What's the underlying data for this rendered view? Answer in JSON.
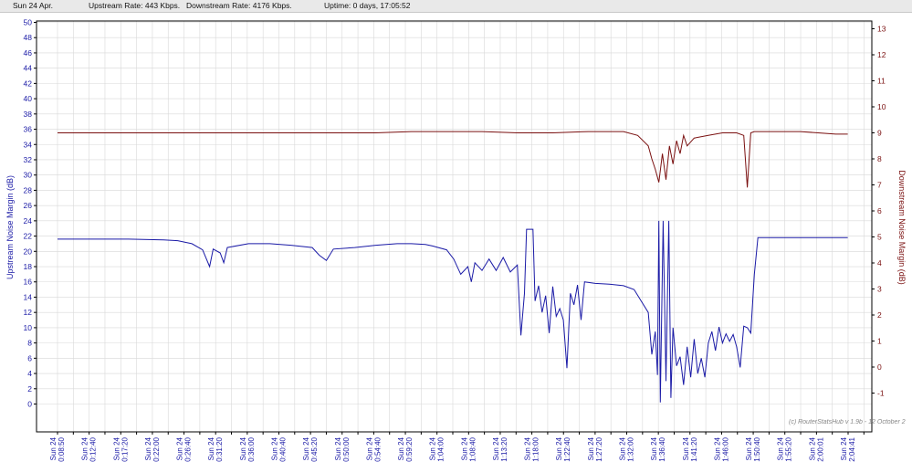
{
  "header": {
    "date": "Sun 24 Apr.",
    "upstream_rate": "Upstream Rate: 443 Kbps.",
    "downstream_rate": "Downstream Rate: 4176 Kbps.",
    "uptime": "Uptime: 0 days, 17:05:52"
  },
  "footer": {
    "copyright": "(c) RouterStatsHub v 1.9b - 12 October 2"
  },
  "colors": {
    "upstream": "#1a1aa6",
    "downstream": "#7a1010",
    "grid": "#d8d8d8",
    "axis": "#000000"
  },
  "chart_data": {
    "type": "line",
    "title": "",
    "xlabel": "",
    "y_left": {
      "label": "Upstream Noise Margin (dB)",
      "min": 0,
      "max": 50,
      "step": 2
    },
    "y_right": {
      "label": "Downstream Noise Margin (dB)",
      "min": -2,
      "max": 13,
      "step": 1
    },
    "x_ticks": [
      {
        "t": 0,
        "date": "Sun 24",
        "time": "20:08:50"
      },
      {
        "t": 0.0447,
        "date": "Sun 24",
        "time": "20:12:40"
      },
      {
        "t": 0.0894,
        "date": "Sun 24",
        "time": "20:17:20"
      },
      {
        "t": 0.1341,
        "date": "Sun 24",
        "time": "20:22:00"
      },
      {
        "t": 0.1788,
        "date": "Sun 24",
        "time": "20:26:40"
      },
      {
        "t": 0.2235,
        "date": "Sun 24",
        "time": "20:31:20"
      },
      {
        "t": 0.2682,
        "date": "Sun 24",
        "time": "20:36:00"
      },
      {
        "t": 0.3129,
        "date": "Sun 24",
        "time": "20:40:40"
      },
      {
        "t": 0.3576,
        "date": "Sun 24",
        "time": "20:45:20"
      },
      {
        "t": 0.4023,
        "date": "Sun 24",
        "time": "20:50:00"
      },
      {
        "t": 0.447,
        "date": "Sun 24",
        "time": "20:54:40"
      },
      {
        "t": 0.4917,
        "date": "Sun 24",
        "time": "20:59:20"
      },
      {
        "t": 0.5364,
        "date": "Sun 24",
        "time": "21:04:00"
      },
      {
        "t": 0.5811,
        "date": "Sun 24",
        "time": "21:08:40"
      },
      {
        "t": 0.6258,
        "date": "Sun 24",
        "time": "21:13:20"
      },
      {
        "t": 0.6705,
        "date": "Sun 24",
        "time": "21:18:00"
      },
      {
        "t": 0.7152,
        "date": "Sun 24",
        "time": "21:22:40"
      },
      {
        "t": 0.7599,
        "date": "Sun 24",
        "time": "21:27:20"
      },
      {
        "t": 0.8046,
        "date": "Sun 24",
        "time": "21:32:00"
      },
      {
        "t": 0.8493,
        "date": "Sun 24",
        "time": "21:36:40"
      },
      {
        "t": 0.894,
        "date": "Sun 24",
        "time": "21:41:20"
      },
      {
        "t": 0.9387,
        "date": "Sun 24",
        "time": "21:46:00"
      },
      {
        "t": 0.9834,
        "date": "Sun 24",
        "time": "21:50:40"
      },
      {
        "t": 1.0281,
        "date": "Sun 24",
        "time": "21:55:20"
      },
      {
        "t": 1.0728,
        "date": "Sun 24",
        "time": "22:00:01"
      },
      {
        "t": 1.1175,
        "date": "Sun 24",
        "time": "22:04:41"
      }
    ],
    "x_range": [
      0,
      1.1175
    ],
    "grid": true,
    "series": [
      {
        "name": "Upstream Noise Margin (dB)",
        "axis": "left",
        "points": [
          [
            0,
            21.6
          ],
          [
            0.05,
            21.6
          ],
          [
            0.1,
            21.6
          ],
          [
            0.15,
            21.5
          ],
          [
            0.17,
            21.4
          ],
          [
            0.19,
            21
          ],
          [
            0.205,
            20.2
          ],
          [
            0.215,
            18
          ],
          [
            0.22,
            20.3
          ],
          [
            0.23,
            19.8
          ],
          [
            0.235,
            18.5
          ],
          [
            0.24,
            20.5
          ],
          [
            0.27,
            21
          ],
          [
            0.3,
            21
          ],
          [
            0.33,
            20.8
          ],
          [
            0.36,
            20.5
          ],
          [
            0.37,
            19.5
          ],
          [
            0.38,
            18.8
          ],
          [
            0.39,
            20.3
          ],
          [
            0.42,
            20.5
          ],
          [
            0.45,
            20.8
          ],
          [
            0.48,
            21
          ],
          [
            0.5,
            21
          ],
          [
            0.52,
            20.9
          ],
          [
            0.53,
            20.7
          ],
          [
            0.55,
            20.2
          ],
          [
            0.56,
            19
          ],
          [
            0.57,
            17
          ],
          [
            0.58,
            18
          ],
          [
            0.585,
            16
          ],
          [
            0.59,
            18.5
          ],
          [
            0.6,
            17.5
          ],
          [
            0.61,
            19
          ],
          [
            0.62,
            17.5
          ],
          [
            0.63,
            19.2
          ],
          [
            0.64,
            17.3
          ],
          [
            0.65,
            18.2
          ],
          [
            0.655,
            9
          ],
          [
            0.66,
            14.5
          ],
          [
            0.663,
            22.9
          ],
          [
            0.672,
            22.9
          ],
          [
            0.675,
            13.5
          ],
          [
            0.68,
            15.5
          ],
          [
            0.685,
            12
          ],
          [
            0.69,
            14.2
          ],
          [
            0.695,
            9.3
          ],
          [
            0.7,
            15.4
          ],
          [
            0.705,
            11.5
          ],
          [
            0.71,
            12.5
          ],
          [
            0.715,
            11
          ],
          [
            0.72,
            4.7
          ],
          [
            0.725,
            14.5
          ],
          [
            0.73,
            13
          ],
          [
            0.735,
            15.6
          ],
          [
            0.74,
            11
          ],
          [
            0.745,
            16
          ],
          [
            0.76,
            15.8
          ],
          [
            0.78,
            15.7
          ],
          [
            0.8,
            15.5
          ],
          [
            0.815,
            15
          ],
          [
            0.825,
            13.5
          ],
          [
            0.835,
            12
          ],
          [
            0.84,
            6.5
          ],
          [
            0.845,
            9.5
          ],
          [
            0.848,
            3.8
          ],
          [
            0.85,
            24
          ],
          [
            0.852,
            0.2
          ],
          [
            0.856,
            24
          ],
          [
            0.86,
            3
          ],
          [
            0.864,
            24
          ],
          [
            0.867,
            0.8
          ],
          [
            0.87,
            10
          ],
          [
            0.875,
            5
          ],
          [
            0.88,
            6.2
          ],
          [
            0.885,
            2.5
          ],
          [
            0.89,
            7.5
          ],
          [
            0.895,
            3.5
          ],
          [
            0.9,
            8.5
          ],
          [
            0.905,
            4
          ],
          [
            0.91,
            6
          ],
          [
            0.915,
            3.5
          ],
          [
            0.92,
            8
          ],
          [
            0.925,
            9.5
          ],
          [
            0.93,
            7
          ],
          [
            0.935,
            10.1
          ],
          [
            0.94,
            8
          ],
          [
            0.945,
            9.2
          ],
          [
            0.95,
            8.2
          ],
          [
            0.955,
            9.1
          ],
          [
            0.96,
            7.5
          ],
          [
            0.965,
            4.8
          ],
          [
            0.97,
            10.2
          ],
          [
            0.975,
            10
          ],
          [
            0.98,
            9.3
          ],
          [
            0.985,
            17
          ],
          [
            0.99,
            21.8
          ],
          [
            1.02,
            21.8
          ],
          [
            1.06,
            21.8
          ],
          [
            1.1,
            21.8
          ],
          [
            1.117,
            21.8
          ]
        ]
      },
      {
        "name": "Downstream Noise Margin (dB)",
        "axis": "right",
        "points": [
          [
            0,
            9
          ],
          [
            0.05,
            9
          ],
          [
            0.1,
            9
          ],
          [
            0.15,
            9
          ],
          [
            0.2,
            9
          ],
          [
            0.25,
            9
          ],
          [
            0.3,
            9
          ],
          [
            0.35,
            9
          ],
          [
            0.4,
            9
          ],
          [
            0.45,
            9
          ],
          [
            0.5,
            9.05
          ],
          [
            0.55,
            9.05
          ],
          [
            0.6,
            9.05
          ],
          [
            0.65,
            9
          ],
          [
            0.7,
            9
          ],
          [
            0.75,
            9.05
          ],
          [
            0.8,
            9.05
          ],
          [
            0.82,
            8.9
          ],
          [
            0.835,
            8.5
          ],
          [
            0.84,
            8
          ],
          [
            0.845,
            7.6
          ],
          [
            0.85,
            7.1
          ],
          [
            0.855,
            8.2
          ],
          [
            0.86,
            7.2
          ],
          [
            0.865,
            8.5
          ],
          [
            0.87,
            7.8
          ],
          [
            0.875,
            8.7
          ],
          [
            0.88,
            8.2
          ],
          [
            0.885,
            8.9
          ],
          [
            0.89,
            8.5
          ],
          [
            0.9,
            8.8
          ],
          [
            0.92,
            8.9
          ],
          [
            0.94,
            9
          ],
          [
            0.96,
            9
          ],
          [
            0.97,
            8.9
          ],
          [
            0.975,
            6.9
          ],
          [
            0.98,
            9
          ],
          [
            0.985,
            9.05
          ],
          [
            1,
            9.05
          ],
          [
            1.05,
            9.05
          ],
          [
            1.1,
            8.95
          ],
          [
            1.117,
            8.95
          ]
        ]
      }
    ]
  }
}
